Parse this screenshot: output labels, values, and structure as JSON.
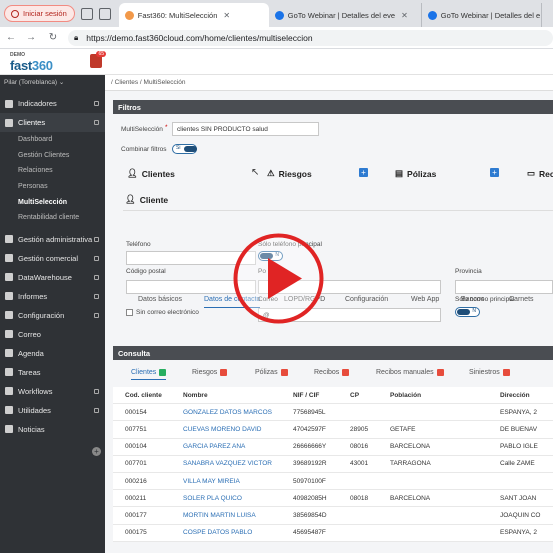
{
  "browser": {
    "signin_label": "Iniciar sesión",
    "tabs": [
      {
        "title": "Fast360: MultiSelección",
        "active": true,
        "fav_color": "#f2994a"
      },
      {
        "title": "GoTo Webinar | Detalles del eve",
        "active": false,
        "fav_color": "#1a73e8"
      },
      {
        "title": "GoTo Webinar | Detalles del e",
        "active": false,
        "fav_color": "#1a73e8"
      }
    ],
    "url": "https://demo.fast360cloud.com/home/clientes/multiseleccion"
  },
  "app": {
    "logo_demo": "DEMO",
    "logo_fast": "fast",
    "logo_num": "360",
    "notif_count": "65",
    "user": "Pilar (Torreblanca)"
  },
  "sidebar": {
    "items": [
      {
        "label": "Indicadores",
        "toggle": true
      },
      {
        "label": "Clientes",
        "toggle": true,
        "active": true
      }
    ],
    "sub": [
      "Dashboard",
      "Gestión Clientes",
      "Relaciones",
      "Personas",
      "MultiSelección",
      "Rentabilidad cliente"
    ],
    "items2": [
      {
        "label": "Gestión administrativa",
        "toggle": true
      },
      {
        "label": "Gestión comercial",
        "toggle": true
      },
      {
        "label": "DataWarehouse",
        "toggle": true
      },
      {
        "label": "Informes",
        "toggle": true
      },
      {
        "label": "Configuración",
        "toggle": true
      },
      {
        "label": "Correo",
        "toggle": false
      },
      {
        "label": "Agenda",
        "toggle": false
      },
      {
        "label": "Tareas",
        "toggle": false
      },
      {
        "label": "Workflows",
        "toggle": true
      },
      {
        "label": "Utilidades",
        "toggle": true
      },
      {
        "label": "Noticias",
        "toggle": false
      }
    ]
  },
  "breadcrumb": {
    "sep": "/",
    "parent": "Clientes",
    "current": "MultiSelección"
  },
  "filtros": {
    "title": "Filtros",
    "multisel_label": "MultiSelección",
    "multisel_value": "clientes SIN PRODUCTO salud",
    "combinar_label": "Combinar filtros",
    "toggle_text": "Si",
    "categories": [
      "Clientes",
      "Riesgos",
      "Pólizas",
      "Rec"
    ],
    "cliente_title": "Cliente",
    "tabs": [
      "Datos básicos",
      "Datos de contacto",
      "LOPD/RGPD",
      "Configuración",
      "Web App",
      "Bancos",
      "Carnets"
    ],
    "telefono": "Teléfono",
    "solo_tel": "Sólo teléfono principal",
    "codigo_postal": "Código postal",
    "poblacion": "Po",
    "provincia": "Provincia",
    "correo": "Correo",
    "correo_value": "@",
    "sin_correo": "Sin correo electrónico",
    "solo_correo": "Sólo correo principal",
    "toggle_no": "N"
  },
  "consulta": {
    "title": "Consulta",
    "tabs": [
      {
        "label": "Clientes",
        "color": "#27ae60",
        "active": true
      },
      {
        "label": "Riesgos",
        "color": "#e74c3c"
      },
      {
        "label": "Pólizas",
        "color": "#e74c3c"
      },
      {
        "label": "Recibos",
        "color": "#e74c3c"
      },
      {
        "label": "Recibos manuales",
        "color": "#e74c3c"
      },
      {
        "label": "Siniestros",
        "color": "#e74c3c"
      }
    ],
    "headers": [
      "Cod. cliente",
      "Nombre",
      "NIF / CIF",
      "CP",
      "Población",
      "Dirección"
    ],
    "rows": [
      [
        "000154",
        "GONZALEZ DATOS MARCOS",
        "77568945L",
        "",
        "",
        "ESPANYA, 2"
      ],
      [
        "007751",
        "CUEVAS MORENO DAVID",
        "47042597F",
        "28905",
        "GETAFE",
        "DE BUENAV"
      ],
      [
        "000104",
        "GARCIA PAREZ ANA",
        "26666666Y",
        "08016",
        "BARCELONA",
        "PABLO IGLE"
      ],
      [
        "007701",
        "SANABRA VAZQUEZ VICTOR",
        "39689192R",
        "43001",
        "TARRAGONA",
        "Calle ZAME"
      ],
      [
        "000216",
        "VILLA MAY MIREIA",
        "50970100F",
        "",
        "",
        ""
      ],
      [
        "000211",
        "SOLER PLA QUICO",
        "40982085H",
        "08018",
        "BARCELONA",
        "SANT JOAN"
      ],
      [
        "000177",
        "MORTIN MARTIN LUISA",
        "38569854D",
        "",
        "",
        "JOAQUIN CO"
      ],
      [
        "000175",
        "COSPE DATOS PABLO",
        "45695487F",
        "",
        "",
        "ESPANYA, 2"
      ]
    ]
  }
}
